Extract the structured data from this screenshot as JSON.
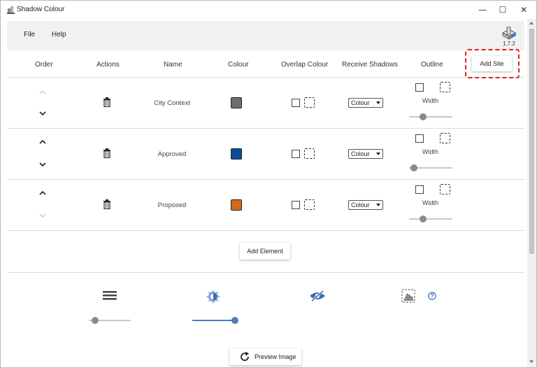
{
  "window": {
    "title": "Shadow Colour",
    "controls": {
      "minimize": "—",
      "maximize": "☐",
      "close": "✕"
    }
  },
  "menu": {
    "file": "File",
    "help": "Help",
    "version": "1.7.2"
  },
  "table": {
    "headers": {
      "order": "Order",
      "actions": "Actions",
      "name": "Name",
      "colour": "Colour",
      "overlap": "Overlap Colour",
      "receive": "Receive Shadows",
      "outline": "Outline"
    },
    "add_site_label": "Add Site",
    "rows": [
      {
        "name": "City Context",
        "colour": "#6e6e6e",
        "receive": "Colour",
        "width_label": "Width",
        "width_value": 0.25,
        "up_enabled": false,
        "down_enabled": true
      },
      {
        "name": "Approved",
        "colour": "#0d4a9c",
        "receive": "Colour",
        "width_label": "Width",
        "width_value": 0.1,
        "up_enabled": true,
        "down_enabled": true
      },
      {
        "name": "Proposed",
        "colour": "#d06a1e",
        "receive": "Colour",
        "width_label": "Width",
        "width_value": 0.25,
        "up_enabled": true,
        "down_enabled": false
      }
    ],
    "add_element_label": "Add Element"
  },
  "tools": {
    "icons": [
      "layers-icon",
      "brightness-icon",
      "visibility-off-icon",
      "ground-plane-icon",
      "help-icon"
    ],
    "opacity_value": 0.15,
    "brightness_value": 0.85,
    "accent_color": "#4a7cc0"
  },
  "preview": {
    "label": "Preview Image"
  }
}
